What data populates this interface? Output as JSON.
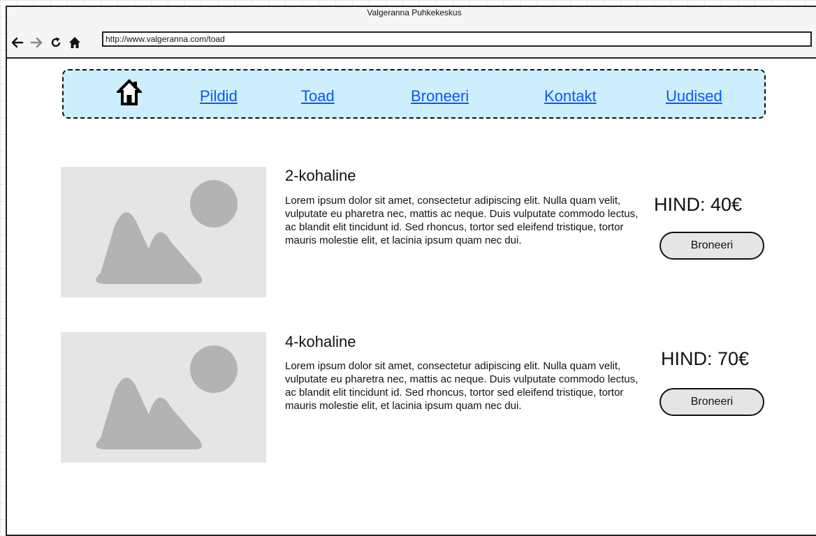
{
  "browser": {
    "window_title": "Valgeranna Puhkekeskus",
    "url": "http://www.valgeranna.com/toad"
  },
  "nav": {
    "home_icon": "home-icon",
    "items": [
      {
        "label": "Pildid"
      },
      {
        "label": "Toad"
      },
      {
        "label": "Broneeri"
      },
      {
        "label": "Kontakt"
      },
      {
        "label": "Uudised"
      }
    ]
  },
  "rooms": [
    {
      "title": "2-kohaline",
      "description": "Lorem ipsum dolor sit amet, consectetur adipiscing elit. Nulla quam velit, vulputate eu pharetra nec, mattis ac neque. Duis vulputate commodo lectus, ac blandit elit tincidunt id. Sed rhoncus, tortor sed eleifend tristique, tortor mauris molestie elit, et lacinia ipsum quam nec dui.",
      "price": "HIND: 40€",
      "button": "Broneeri"
    },
    {
      "title": "4-kohaline",
      "description": "Lorem ipsum dolor sit amet, consectetur adipiscing elit. Nulla quam velit, vulputate eu pharetra nec, mattis ac neque. Duis vulputate commodo lectus, ac blandit elit tincidunt id. Sed rhoncus, tortor sed eleifend tristique, tortor mauris molestie elit, et lacinia ipsum quam nec dui.",
      "price": "HIND: 70€",
      "button": "Broneeri"
    }
  ],
  "colors": {
    "navbar_bg": "#cdeefc",
    "link": "#0b56ff",
    "placeholder_bg": "#e5e5e5",
    "placeholder_shape": "#b3b3b3"
  }
}
